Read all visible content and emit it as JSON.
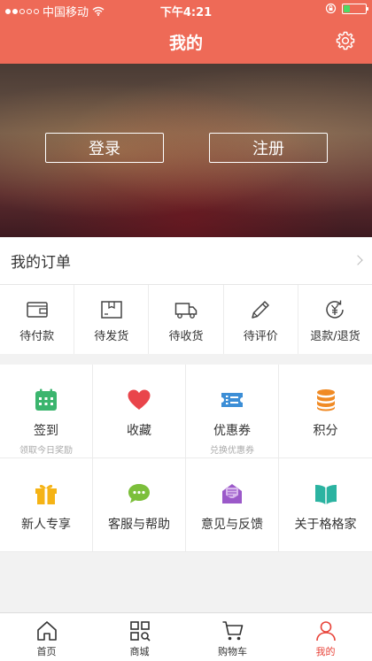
{
  "status_bar": {
    "carrier": "中国移动",
    "time": "下午4:21",
    "battery_level": 0.3,
    "signal_bars_filled": 2,
    "signal_bars_total": 5
  },
  "header": {
    "title": "我的",
    "settings_icon": "gear-icon"
  },
  "banner": {
    "login_label": "登录",
    "register_label": "注册"
  },
  "orders": {
    "title": "我的订单",
    "items": [
      {
        "label": "待付款",
        "icon": "wallet-icon"
      },
      {
        "label": "待发货",
        "icon": "package-icon"
      },
      {
        "label": "待收货",
        "icon": "truck-icon"
      },
      {
        "label": "待评价",
        "icon": "pencil-icon"
      },
      {
        "label": "退款/退货",
        "icon": "refund-icon"
      }
    ]
  },
  "features": [
    {
      "label": "签到",
      "sub": "领取今日奖励",
      "icon": "calendar-icon",
      "color": "#3bb56e"
    },
    {
      "label": "收藏",
      "sub": "",
      "icon": "heart-icon",
      "color": "#e9454b"
    },
    {
      "label": "优惠券",
      "sub": "兑换优惠券",
      "icon": "coupon-icon",
      "color": "#3c8ed6"
    },
    {
      "label": "积分",
      "sub": "",
      "icon": "coins-icon",
      "color": "#f08a24"
    },
    {
      "label": "新人专享",
      "sub": "",
      "icon": "gift-icon",
      "color": "#f5b315"
    },
    {
      "label": "客服与帮助",
      "sub": "",
      "icon": "chat-icon",
      "color": "#7cbf3b"
    },
    {
      "label": "意见与反馈",
      "sub": "",
      "icon": "feedback-mail-icon",
      "color": "#9b59c9"
    },
    {
      "label": "关于格格家",
      "sub": "",
      "icon": "book-icon",
      "color": "#2bb3a1"
    }
  ],
  "tabbar": {
    "items": [
      {
        "label": "首页",
        "icon": "home-icon",
        "active": false
      },
      {
        "label": "商城",
        "icon": "mall-grid-icon",
        "active": false
      },
      {
        "label": "购物车",
        "icon": "cart-icon",
        "active": false
      },
      {
        "label": "我的",
        "icon": "user-icon",
        "active": true
      }
    ],
    "active_color": "#e8443a"
  },
  "colors": {
    "header_bg": "#ee6a57",
    "accent": "#e8443a"
  }
}
